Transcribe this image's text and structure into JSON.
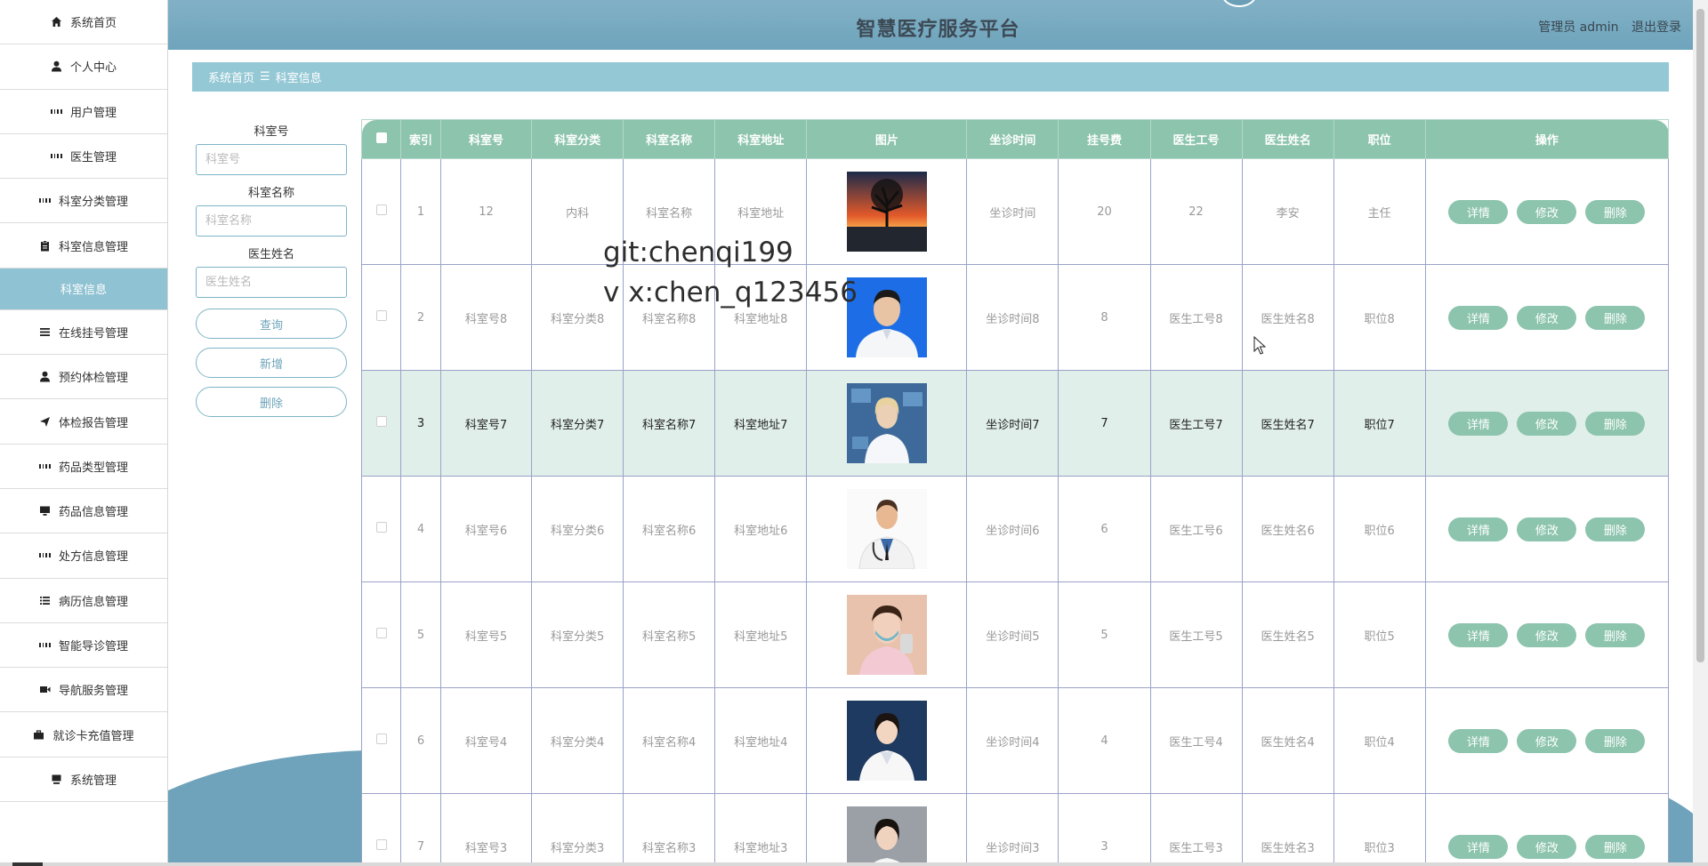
{
  "sidebar": {
    "items": [
      {
        "label": "系统首页",
        "icon": "home-icon"
      },
      {
        "label": "个人中心",
        "icon": "person-icon"
      },
      {
        "label": "用户管理",
        "icon": "grid-icon"
      },
      {
        "label": "医生管理",
        "icon": "grid-icon"
      },
      {
        "label": "科室分类管理",
        "icon": "grid-icon"
      },
      {
        "label": "科室信息管理",
        "icon": "clipboard-icon"
      },
      {
        "label": "科室信息",
        "icon": ""
      },
      {
        "label": "在线挂号管理",
        "icon": "list-icon"
      },
      {
        "label": "预约体检管理",
        "icon": "person-icon"
      },
      {
        "label": "体检报告管理",
        "icon": "send-icon"
      },
      {
        "label": "药品类型管理",
        "icon": "grid-icon"
      },
      {
        "label": "药品信息管理",
        "icon": "monitor-icon"
      },
      {
        "label": "处方信息管理",
        "icon": "grid-icon"
      },
      {
        "label": "病历信息管理",
        "icon": "list-icon"
      },
      {
        "label": "智能导诊管理",
        "icon": "grid-icon"
      },
      {
        "label": "导航服务管理",
        "icon": "video-icon"
      },
      {
        "label": "就诊卡充值管理",
        "icon": "briefcase-icon"
      },
      {
        "label": "系统管理",
        "icon": "monitor-icon"
      }
    ]
  },
  "header": {
    "title": "智慧医疗服务平台",
    "user": "管理员 admin",
    "logout": "退出登录"
  },
  "breadcrumb": {
    "home": "系统首页",
    "sep": "☰",
    "current": "科室信息"
  },
  "search": {
    "dept_no_label": "科室号",
    "dept_no_placeholder": "科室号",
    "dept_name_label": "科室名称",
    "dept_name_placeholder": "科室名称",
    "doctor_label": "医生姓名",
    "doctor_placeholder": "医生姓名",
    "query": "查询",
    "add": "新增",
    "delete": "删除"
  },
  "table": {
    "headers": [
      "索引",
      "科室号",
      "科室分类",
      "科室名称",
      "科室地址",
      "图片",
      "坐诊时间",
      "挂号费",
      "医生工号",
      "医生姓名",
      "职位",
      "操作"
    ],
    "actions": {
      "detail": "详情",
      "edit": "修改",
      "delete": "删除"
    },
    "rows": [
      {
        "index": "1",
        "dept_no": "12",
        "category": "内科",
        "name": "科室名称",
        "address": "科室地址",
        "time": "坐诊时间",
        "fee": "20",
        "doc_no": "22",
        "doc_name": "李安",
        "title": "主任",
        "image": "sunset-tree-photo"
      },
      {
        "index": "2",
        "dept_no": "科室号8",
        "category": "科室分类8",
        "name": "科室名称8",
        "address": "科室地址8",
        "time": "坐诊时间8",
        "fee": "8",
        "doc_no": "医生工号8",
        "doc_name": "医生姓名8",
        "title": "职位8",
        "image": "doctor-blue-bg-photo"
      },
      {
        "index": "3",
        "dept_no": "科室号7",
        "category": "科室分类7",
        "name": "科室名称7",
        "address": "科室地址7",
        "time": "坐诊时间7",
        "fee": "7",
        "doc_no": "医生工号7",
        "doc_name": "医生姓名7",
        "title": "职位7",
        "image": "doctor-digital-photo"
      },
      {
        "index": "4",
        "dept_no": "科室号6",
        "category": "科室分类6",
        "name": "科室名称6",
        "address": "科室地址6",
        "time": "坐诊时间6",
        "fee": "6",
        "doc_no": "医生工号6",
        "doc_name": "医生姓名6",
        "title": "职位6",
        "image": "doctor-stethoscope-photo"
      },
      {
        "index": "5",
        "dept_no": "科室号5",
        "category": "科室分类5",
        "name": "科室名称5",
        "address": "科室地址5",
        "time": "坐诊时间5",
        "fee": "5",
        "doc_no": "医生工号5",
        "doc_name": "医生姓名5",
        "title": "职位5",
        "image": "nurse-mask-photo"
      },
      {
        "index": "6",
        "dept_no": "科室号4",
        "category": "科室分类4",
        "name": "科室名称4",
        "address": "科室地址4",
        "time": "坐诊时间4",
        "fee": "4",
        "doc_no": "医生工号4",
        "doc_name": "医生姓名4",
        "title": "职位4",
        "image": "female-doctor-dark-photo"
      },
      {
        "index": "7",
        "dept_no": "科室号3",
        "category": "科室分类3",
        "name": "科室名称3",
        "address": "科室地址3",
        "time": "坐诊时间3",
        "fee": "3",
        "doc_no": "医生工号3",
        "doc_name": "医生姓名3",
        "title": "职位3",
        "image": "female-doctor-grey-photo"
      }
    ]
  },
  "watermark": {
    "line1": "git:chenqi199",
    "line2": "v x:chen_q123456"
  },
  "colors": {
    "header": "#78aac0",
    "breadcrumb": "#94c8d5",
    "table_header": "#8cc4ad",
    "button": "#8cc4ad",
    "active_sidebar": "#8fc2d2"
  }
}
